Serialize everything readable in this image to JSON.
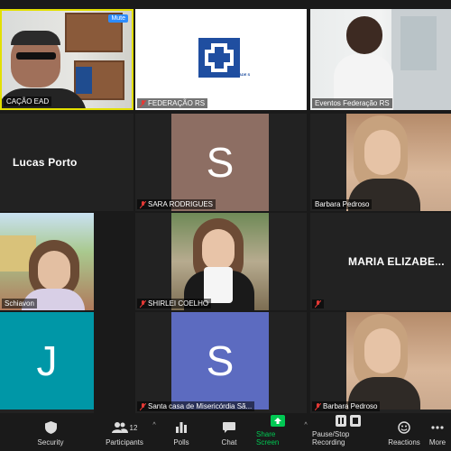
{
  "tiles": [
    {
      "name": "CAÇÃO EAD",
      "mute_label": "Mute"
    },
    {
      "name": "FEDERAÇÃO RS",
      "logo_text": "ENTIDADE S"
    },
    {
      "name": "Eventos Federação RS"
    },
    {
      "big_name": "Lucas Porto"
    },
    {
      "name": "SARA RODRIGUES",
      "initial": "S"
    },
    {
      "name": "Barbara Pedroso"
    },
    {
      "name": "Schiavon"
    },
    {
      "name": "SHIRLEI COELHO"
    },
    {
      "big_name": "MARIA  ELIZABE..."
    },
    {
      "initial": "J"
    },
    {
      "name": "Santa casa de Misericórdia Sã...",
      "initial": "S"
    },
    {
      "name": "Barbara Pedroso"
    }
  ],
  "toolbar": {
    "security": "Security",
    "participants": "Participants",
    "participants_count": "12",
    "polls": "Polls",
    "chat": "Chat",
    "share": "Share Screen",
    "record": "Pause/Stop Recording",
    "reactions": "Reactions",
    "more": "More"
  },
  "colors": {
    "active_border": "#e3e000",
    "avatar_sara": "#8d6e63",
    "avatar_j": "#0097a7",
    "avatar_santa": "#5c6bc0",
    "share_green": "#00c853",
    "mute_blue": "#2d8cff"
  }
}
